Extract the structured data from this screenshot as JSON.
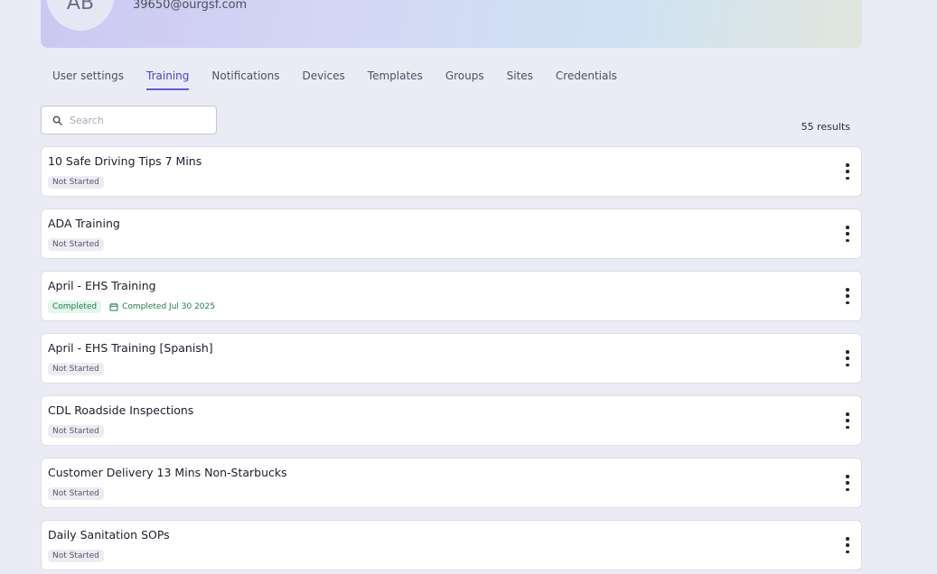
{
  "profile": {
    "initials": "AB",
    "email": "39650@ourgsf.com"
  },
  "tabs": [
    {
      "label": "User settings",
      "active": false
    },
    {
      "label": "Training",
      "active": true
    },
    {
      "label": "Notifications",
      "active": false
    },
    {
      "label": "Devices",
      "active": false
    },
    {
      "label": "Templates",
      "active": false
    },
    {
      "label": "Groups",
      "active": false
    },
    {
      "label": "Sites",
      "active": false
    },
    {
      "label": "Credentials",
      "active": false
    }
  ],
  "search": {
    "placeholder": "Search",
    "value": ""
  },
  "results": {
    "count_label": "55 results"
  },
  "trainings": [
    {
      "title": "10 Safe Driving Tips 7 Mins",
      "status": "Not Started"
    },
    {
      "title": "ADA Training",
      "status": "Not Started"
    },
    {
      "title": "April - EHS Training",
      "status": "Completed",
      "completed_date": "Completed Jul 30 2025"
    },
    {
      "title": "April - EHS Training [Spanish]",
      "status": "Not Started"
    },
    {
      "title": "CDL Roadside Inspections",
      "status": "Not Started"
    },
    {
      "title": "Customer Delivery 13 Mins Non-Starbucks",
      "status": "Not Started"
    },
    {
      "title": "Daily Sanitation SOPs",
      "status": "Not Started"
    }
  ],
  "colors": {
    "accent": "#4b3fd0",
    "completed": "#1d7f4d",
    "background": "#ebebf6"
  }
}
